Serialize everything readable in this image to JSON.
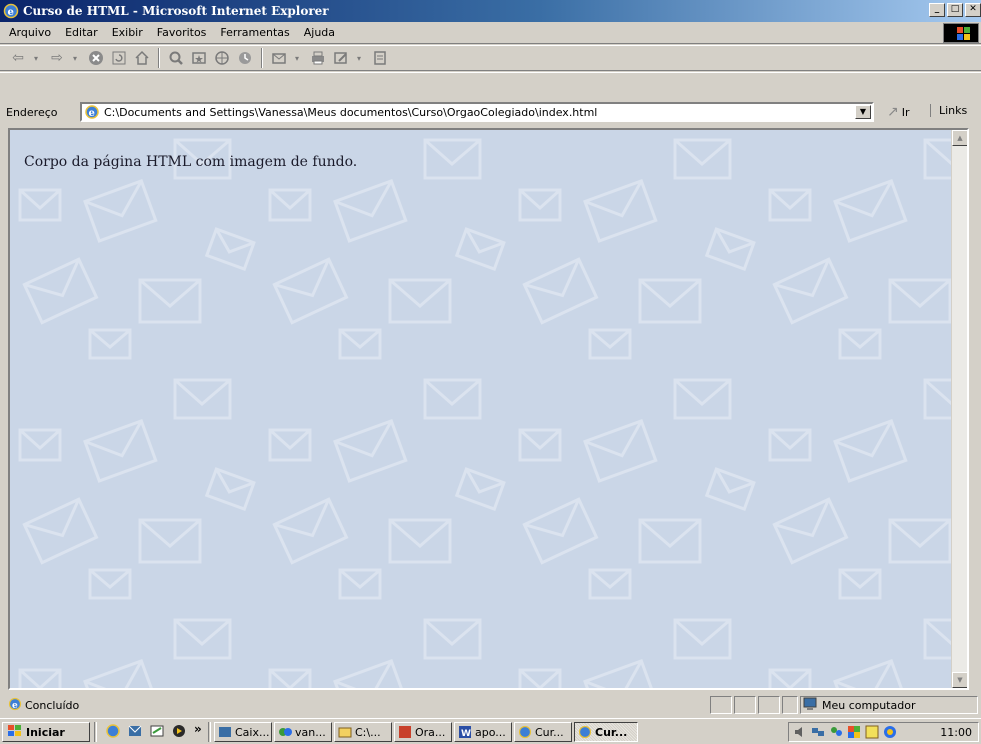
{
  "window": {
    "title": "Curso de HTML - Microsoft Internet Explorer"
  },
  "menubar": {
    "items": [
      "Arquivo",
      "Editar",
      "Exibir",
      "Favoritos",
      "Ferramentas",
      "Ajuda"
    ]
  },
  "address": {
    "label": "Endereço",
    "url": "C:\\Documents and Settings\\Vanessa\\Meus documentos\\Curso\\OrgaoColegiado\\index.html",
    "go_label": "Ir",
    "links_label": "Links"
  },
  "page": {
    "body_text": "Corpo da página HTML com imagem de fundo.",
    "background_color": "#cad6e7"
  },
  "status": {
    "text": "Concluído",
    "zone": "Meu computador"
  },
  "taskbar": {
    "start_label": "Iniciar",
    "tasks": [
      "Caix...",
      "van...",
      "C:\\...",
      "Ora...",
      "apo...",
      "Cur...",
      "Cur..."
    ],
    "clock": "11:00"
  },
  "colors": {
    "title_gradient_start": "#0a246a",
    "title_gradient_end": "#a6caf0",
    "chrome": "#d4d0c8"
  }
}
